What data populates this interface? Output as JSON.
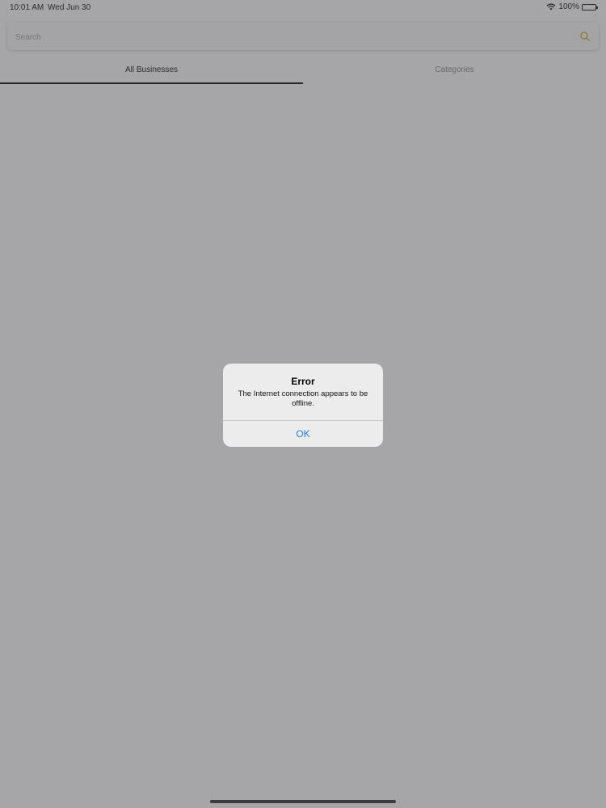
{
  "status_bar": {
    "time": "10:01 AM",
    "date": "Wed Jun 30",
    "battery": "100%",
    "wifi_icon": "wifi-icon",
    "battery_icon": "battery-icon"
  },
  "search": {
    "placeholder": "Search",
    "icon": "search-icon",
    "accent_color": "#d8b23a"
  },
  "tabs": [
    {
      "label": "All Businesses",
      "selected": true
    },
    {
      "label": "Categories",
      "selected": false
    }
  ],
  "alert": {
    "title": "Error",
    "message": "The Internet connection appears to be offline.",
    "ok_label": "OK",
    "ok_color": "#1a7fe6"
  }
}
